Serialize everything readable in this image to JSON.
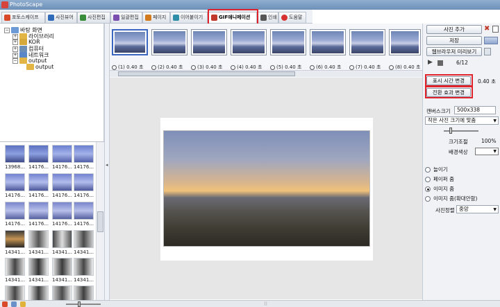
{
  "window": {
    "title": "PhotoScape"
  },
  "tabs": [
    {
      "label": "포토스케이프",
      "color": "#d94a2a"
    },
    {
      "label": "사진뷰어",
      "color": "#2f6bb8"
    },
    {
      "label": "사진편집",
      "color": "#3a8d3a"
    },
    {
      "label": "일괄편집",
      "color": "#7a4fb0"
    },
    {
      "label": "페이지",
      "color": "#d27a1e"
    },
    {
      "label": "이어붙이기",
      "color": "#2f8fa8"
    },
    {
      "label": "GIF애니메이션",
      "color": "#c0392b"
    },
    {
      "label": "인쇄",
      "color": "#555555"
    },
    {
      "label": "도움말",
      "color": "#d63030"
    }
  ],
  "tree": {
    "root": "바탕 화면",
    "items": [
      "라이브러리",
      "KOR",
      "컴퓨터",
      "네트워크",
      "output"
    ],
    "child": "output"
  },
  "gallery": {
    "labels": [
      "13968...",
      "14176...",
      "14176...",
      "14176...",
      "14176...",
      "14176...",
      "14176...",
      "14176...",
      "14176...",
      "14176...",
      "14176...",
      "14176...",
      "14341...",
      "14341...",
      "14341...",
      "14341...",
      "14341...",
      "14341...",
      "14341...",
      "14341..."
    ]
  },
  "frames": [
    {
      "caption": "(1) 0.40 초"
    },
    {
      "caption": "(2) 0.40 초"
    },
    {
      "caption": "(3) 0.40 초"
    },
    {
      "caption": "(4) 0.40 초"
    },
    {
      "caption": "(5) 0.40 초"
    },
    {
      "caption": "(6) 0.40 초"
    },
    {
      "caption": "(7) 0.40 초"
    },
    {
      "caption": "(8) 0.40 초"
    }
  ],
  "right": {
    "add_photo": "사진 추가",
    "save": "저장",
    "browser_preview": "웹브라우저 미리보기",
    "counter": "6/12",
    "display_time_btn": "표시 시간 변경",
    "display_time_value": "0.40 초",
    "transition_btn": "전환 효과 변경",
    "canvas_label": "캔버스크기",
    "canvas_value": "500x338",
    "canvas_select": "작은 사진 크기에 맞춤",
    "scale_label": "크기조절",
    "scale_value": "100%",
    "bg_label": "배경색상",
    "radios": [
      "늘이기",
      "페이퍼 줌",
      "이미지 줌",
      "이미지 줌(확대안함)"
    ],
    "radio_selected": 2,
    "align_label": "사진정렬",
    "align_value": "중앙"
  },
  "highlight_color": "#e0232b"
}
